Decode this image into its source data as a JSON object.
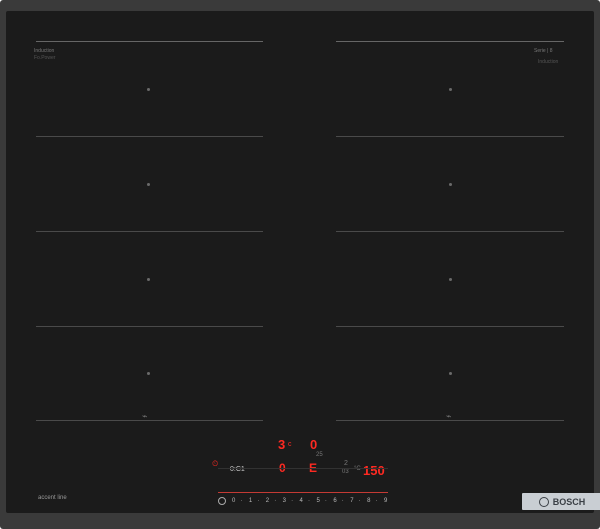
{
  "hob": {
    "brand": "BOSCH",
    "series_label": "accent line",
    "left_panel_label": "Induction",
    "left_panel_sublabel": "Fo.Power",
    "right_panel_label": "Serie | 8",
    "right_panel_sublabel": "Induction"
  },
  "display": {
    "top_left_digit": "3",
    "top_left_superscript": "c",
    "top_right_digit": "0",
    "mid_left_icon": "timer-icon",
    "mid_text": "0:C1",
    "mid_digit": "0",
    "mid_symbol": "E",
    "dim_code": "2",
    "temp_value": "150",
    "temp_unit": "°C",
    "small_code_1": "03",
    "small_code_2": "25"
  },
  "power_scale": {
    "values": [
      "0",
      "·",
      "1",
      "·",
      "2",
      "·",
      "3",
      "·",
      "4",
      "·",
      "5",
      "·",
      "6",
      "·",
      "7",
      "·",
      "8",
      "·",
      "9"
    ]
  },
  "colors": {
    "glass": "#1b1b1b",
    "frame": "#3a3a3a",
    "display_red": "#ff2a22",
    "zone_line": "#4a4a4a",
    "brand_box": "#c9ced3"
  }
}
